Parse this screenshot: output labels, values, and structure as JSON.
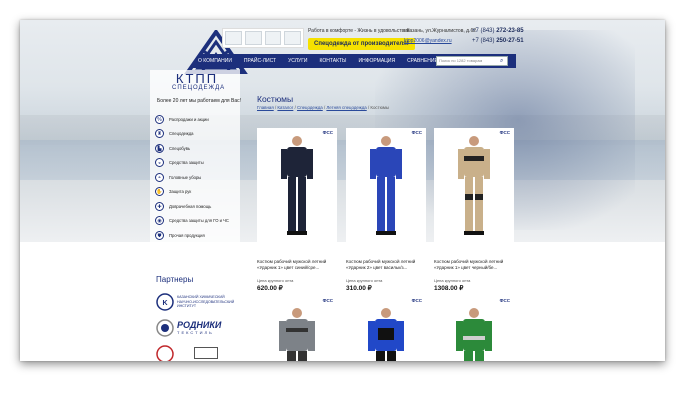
{
  "header": {
    "brand_name": "КТПП",
    "brand_sub": "СПЕЦОДЕЖДА",
    "since": "Более 20 лет мы работаем для Вас!",
    "slogan": "Работа в комфорте - Жизнь в удовольствие",
    "promo": "Спецодежда от производителя!",
    "address": "г.Казань, ул.Журналистов, д.62",
    "email": "ktpp2006@yandex.ru",
    "phone1_prefix": "+7 (843) ",
    "phone1": "272-23-85",
    "phone2_prefix": "+7 (843) ",
    "phone2": "250-27-51"
  },
  "nav": {
    "items": [
      "О КОМПАНИИ",
      "ПРАЙС-ЛИСТ",
      "УСЛУГИ",
      "КОНТАКТЫ",
      "ИНФОРМАЦИЯ",
      "СРАВНЕНИЕ"
    ],
    "search_placeholder": "Поиск по 1282 товарам"
  },
  "sidebar": {
    "categories": [
      {
        "label": "Распродажи и акции",
        "icon": "percent-icon"
      },
      {
        "label": "Спецодежда",
        "icon": "jacket-icon"
      },
      {
        "label": "Спецобувь",
        "icon": "boot-icon"
      },
      {
        "label": "Средства защиты",
        "icon": "respirator-icon"
      },
      {
        "label": "Головные уборы",
        "icon": "helmet-icon"
      },
      {
        "label": "Защита рук",
        "icon": "glove-icon"
      },
      {
        "label": "Доврачебная помощь",
        "icon": "first-aid-icon"
      },
      {
        "label": "Средства защиты для ГО и ЧС",
        "icon": "gasmask-icon"
      },
      {
        "label": "Прочая продукция",
        "icon": "shield-icon"
      }
    ],
    "partners_title": "Партнеры",
    "partner1": "КАЗАНСКИЙ ХИМИЧЕСКИЙ НАУЧНО-ИССЛЕДОВАТЕЛЬСКИЙ ИНСТИТУТ",
    "partner2": "РОДНИКИ",
    "partner2_sub": "ТЕКСТИЛЬ"
  },
  "main": {
    "title": "Костюмы",
    "breadcrumbs": [
      "Главная",
      "Каталог",
      "Спецодежда",
      "Летняя спецодежда",
      "Костюмы"
    ],
    "products": [
      {
        "badge": "ФСС",
        "name": "Костюм рабочий мужской летний «Ударник 1» цвет синий/сре...",
        "price_label": "Цена крупного опта",
        "price": "620.00 ₽",
        "color": "#1e2438"
      },
      {
        "badge": "ФСС",
        "name": "Костюм рабочий мужской летний «Ударник 2» цвет васильк/з...",
        "price_label": "Цена крупного опта",
        "price": "310.00 ₽",
        "color": "#2a46b8"
      },
      {
        "badge": "ФСС",
        "name": "Костюм рабочий мужской летний «Ударник 1» цвет черный/бе...",
        "price_label": "Цена крупного опта",
        "price": "1308.00 ₽",
        "color": "#c9b08a"
      },
      {
        "badge": "ФСС",
        "color": "#7d8288"
      },
      {
        "badge": "ФСС",
        "color": "#2148c8"
      },
      {
        "badge": "ФСС",
        "color": "#2c8a3a"
      }
    ]
  },
  "colors": {
    "brand": "#1c2f7c",
    "promo": "#f6e100"
  }
}
